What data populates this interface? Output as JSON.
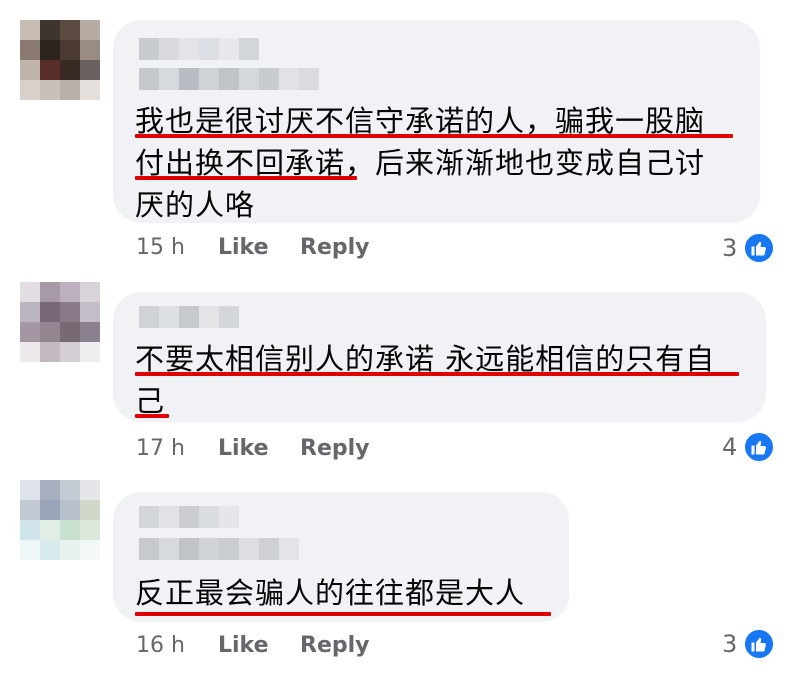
{
  "comments": [
    {
      "text_lines": [
        "我也是很讨厌不信守承诺的人，骗我一股脑",
        "付出换不回承诺，后来渐渐地也变成自己讨",
        "厌的人咯"
      ],
      "time": "15 h",
      "like_label": "Like",
      "reply_label": "Reply",
      "reaction_count": "3",
      "reaction_icon": "like-thumb-icon"
    },
    {
      "text_lines": [
        "不要太相信别人的承诺 永远能相信的只有自",
        "己"
      ],
      "time": "17 h",
      "like_label": "Like",
      "reply_label": "Reply",
      "reaction_count": "4",
      "reaction_icon": "like-thumb-icon"
    },
    {
      "text_lines": [
        "反正最会骗人的往往都是大人"
      ],
      "time": "16 h",
      "like_label": "Like",
      "reply_label": "Reply",
      "reaction_count": "3",
      "reaction_icon": "like-thumb-icon"
    }
  ],
  "colors": {
    "bubble": "#f0f2f5",
    "underline": "#e00000",
    "meta_text": "#65676b",
    "like_badge": "#1877f2"
  }
}
